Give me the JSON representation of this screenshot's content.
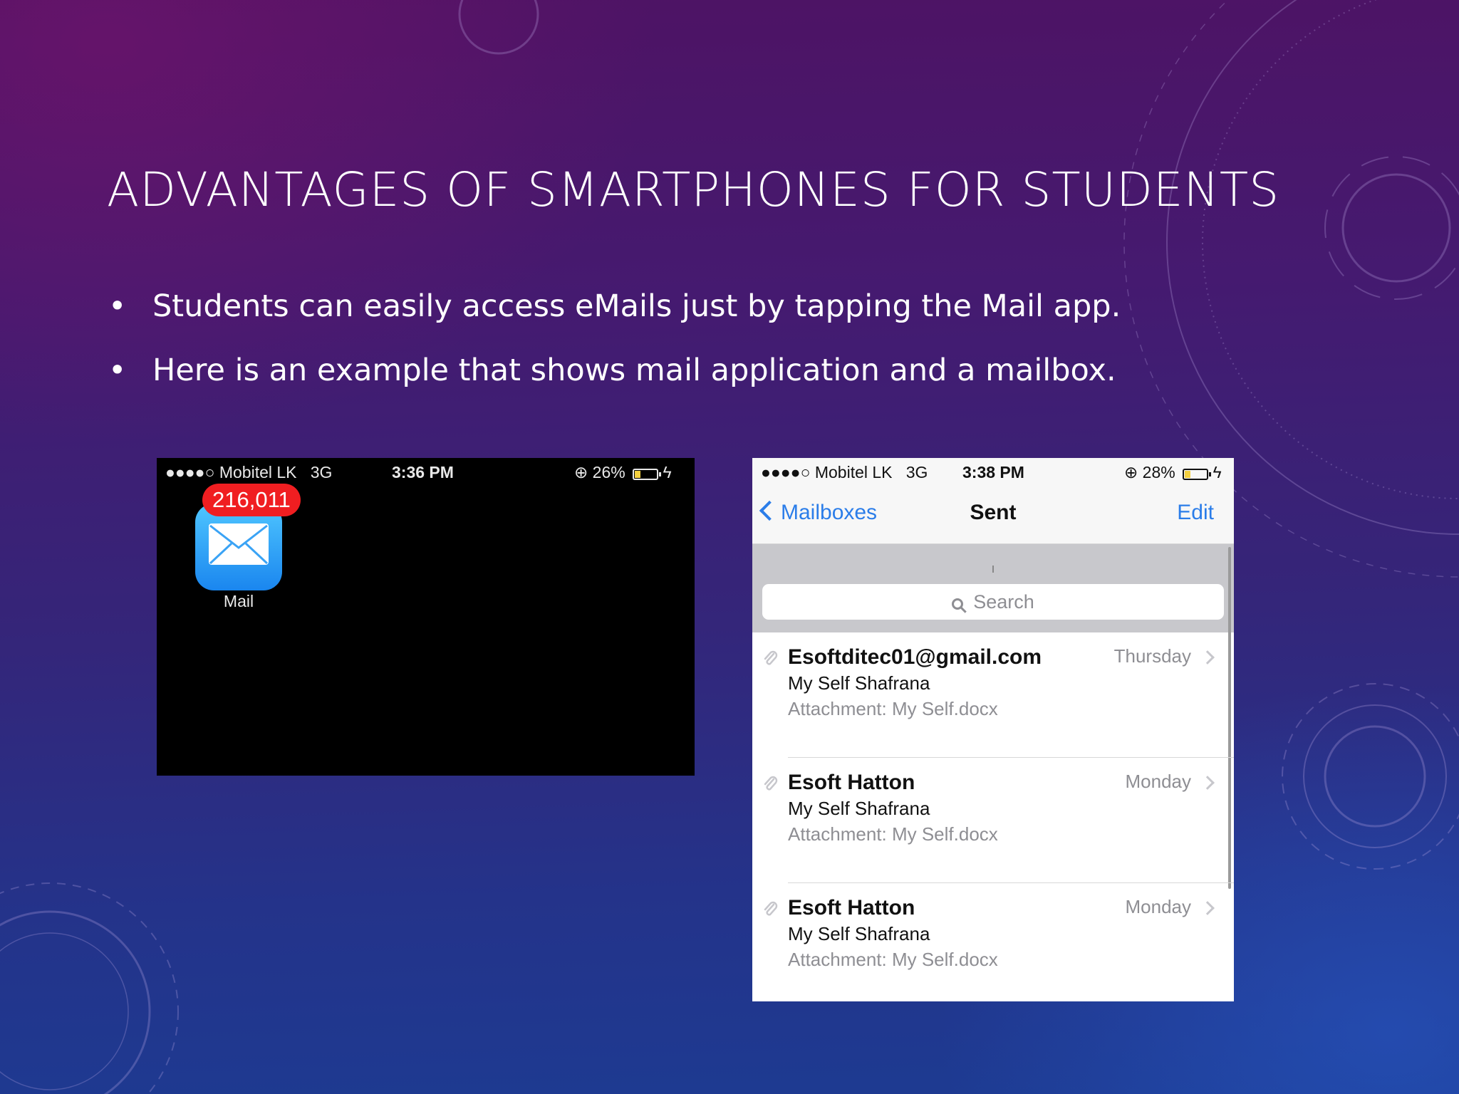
{
  "slide": {
    "title": "ADVANTAGES OF SMARTPHONES FOR STUDENTS",
    "bullet_symbol": "•",
    "bullets": [
      "Students can easily access eMails just by tapping the Mail app.",
      "Here is an example that shows mail application and a mailbox."
    ]
  },
  "home_screenshot": {
    "status": {
      "signal": "●●●●○",
      "carrier": "Mobitel LK",
      "network": "3G",
      "time": "3:36 PM",
      "battery": "26%",
      "battery_level": 0.26
    },
    "app": {
      "label": "Mail",
      "badge": "216,011",
      "icon": "mail-envelope-icon"
    }
  },
  "mail_screenshot": {
    "status": {
      "signal": "●●●●○",
      "carrier": "Mobitel LK",
      "network": "3G",
      "time": "3:38 PM",
      "battery": "28%",
      "battery_level": 0.28
    },
    "nav": {
      "back_label": "Mailboxes",
      "title": "Sent",
      "edit_label": "Edit"
    },
    "search": {
      "placeholder": "Search"
    },
    "messages": [
      {
        "from": "Esoftditec01@gmail.com",
        "date": "Thursday",
        "subject": "My Self Shafrana",
        "preview": "Attachment: My Self.docx"
      },
      {
        "from": "Esoft Hatton",
        "date": "Monday",
        "subject": "My Self Shafrana",
        "preview": "Attachment: My Self.docx"
      },
      {
        "from": "Esoft Hatton",
        "date": "Monday",
        "subject": "My Self Shafrana",
        "preview": "Attachment: My Self.docx"
      }
    ]
  },
  "colors": {
    "ios_blue": "#2b7de9",
    "badge_red": "#f01e21",
    "battery_yellow": "#f4d03f"
  }
}
